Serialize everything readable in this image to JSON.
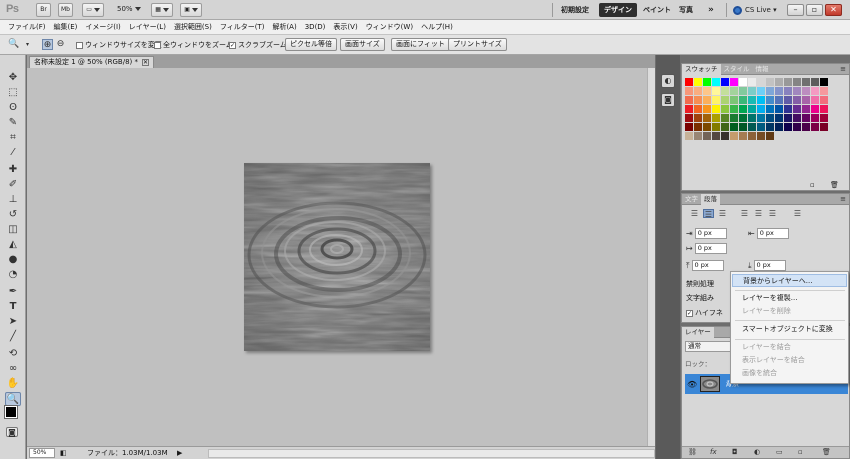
{
  "app": {
    "logo": "Ps",
    "zoom_dropdown": "50%",
    "workspaces": [
      "初期設定",
      "デザイン",
      "ペイント",
      "写真"
    ],
    "more_label": "»",
    "cslive": "CS Live",
    "active_workspace": "デザイン"
  },
  "menu": [
    "ファイル(F)",
    "編集(E)",
    "イメージ(I)",
    "レイヤー(L)",
    "選択範囲(S)",
    "フィルター(T)",
    "解析(A)",
    "3D(D)",
    "表示(V)",
    "ウィンドウ(W)",
    "ヘルプ(H)"
  ],
  "options": {
    "resize_windows": "ウィンドウサイズを変更",
    "all_windows": "全ウィンドウをズーム",
    "scrubby_zoom": "スクラブズーム",
    "actual_pixels": "ピクセル等倍",
    "fit_screen": "画面サイズ",
    "fill_screen": "画面にフィット",
    "print_size": "プリントサイズ"
  },
  "document": {
    "tab_title": "名称未設定 1 @ 50% (RGB/8) *",
    "status_zoom": "50%",
    "status_file": "ファイル：1.03M/1.03M"
  },
  "panels": {
    "swatches_tabs": [
      "スウォッチ",
      "スタイル",
      "情報"
    ],
    "char_tabs": [
      "文字",
      "段落"
    ],
    "para_fields": [
      "0 px",
      "0 px",
      "0 px",
      "0 px",
      "0 px"
    ],
    "para_labels": [
      "禁則処理",
      "文字組み",
      "ハイフネ"
    ],
    "layers_tab": "レイヤー",
    "blend_mode": "通常",
    "lock_label": "ロック：",
    "layer_name": "背景"
  },
  "swatches": [
    "#ff0000",
    "#ffff00",
    "#00ff00",
    "#00ffff",
    "#0000ff",
    "#ff00ff",
    "#ffffff",
    "#ebebeb",
    "#d6d6d6",
    "#c2c2c2",
    "#adadad",
    "#999999",
    "#858585",
    "#707070",
    "#5c5c5c",
    "#000000",
    "#f7977a",
    "#f9ad81",
    "#fdc68a",
    "#fff79a",
    "#c4df9b",
    "#a3d39c",
    "#82ca9d",
    "#7bcdc8",
    "#6ecff6",
    "#7ea7d8",
    "#8493ca",
    "#8882be",
    "#a187be",
    "#bc8dbf",
    "#f49ac2",
    "#f6989d",
    "#f26c4f",
    "#f68e55",
    "#fbaf5c",
    "#fff467",
    "#acd372",
    "#7cc576",
    "#3bb878",
    "#1abbb4",
    "#00bff3",
    "#438ccb",
    "#5574b9",
    "#605ca8",
    "#855fa8",
    "#a763a8",
    "#f06ea9",
    "#f26d7d",
    "#ed1c24",
    "#f26522",
    "#f7941d",
    "#fff200",
    "#8dc63f",
    "#39b54a",
    "#00a651",
    "#00a99d",
    "#00aeef",
    "#0072bc",
    "#0054a6",
    "#2e3192",
    "#662d91",
    "#92278f",
    "#ec008c",
    "#ed145b",
    "#9e0b0f",
    "#a0410d",
    "#a36209",
    "#aba000",
    "#598527",
    "#1a7b30",
    "#007236",
    "#00746b",
    "#0076a3",
    "#004b80",
    "#003471",
    "#1b1464",
    "#440e62",
    "#630460",
    "#9e005d",
    "#9e0039",
    "#790000",
    "#7b2e00",
    "#7d4900",
    "#827b00",
    "#406618",
    "#005e20",
    "#005826",
    "#005952",
    "#005b7f",
    "#003663",
    "#002157",
    "#0d004c",
    "#32004b",
    "#4b0049",
    "#7b0046",
    "#7a0026",
    "#c7b299",
    "#998675",
    "#736357",
    "#534741",
    "#37302d",
    "#c69c6d",
    "#a67c52",
    "#8c6239",
    "#754c24",
    "#603913"
  ],
  "context_menu": [
    {
      "label": "背景からレイヤーへ...",
      "enabled": true,
      "highlight": true
    },
    {
      "label": "レイヤーを複製...",
      "enabled": true
    },
    {
      "label": "レイヤーを削除",
      "enabled": false
    },
    {
      "label": "スマートオブジェクトに変換",
      "enabled": true
    },
    {
      "label": "レイヤーを結合",
      "enabled": false
    },
    {
      "label": "表示レイヤーを結合",
      "enabled": false
    },
    {
      "label": "画像を統合",
      "enabled": false
    }
  ]
}
